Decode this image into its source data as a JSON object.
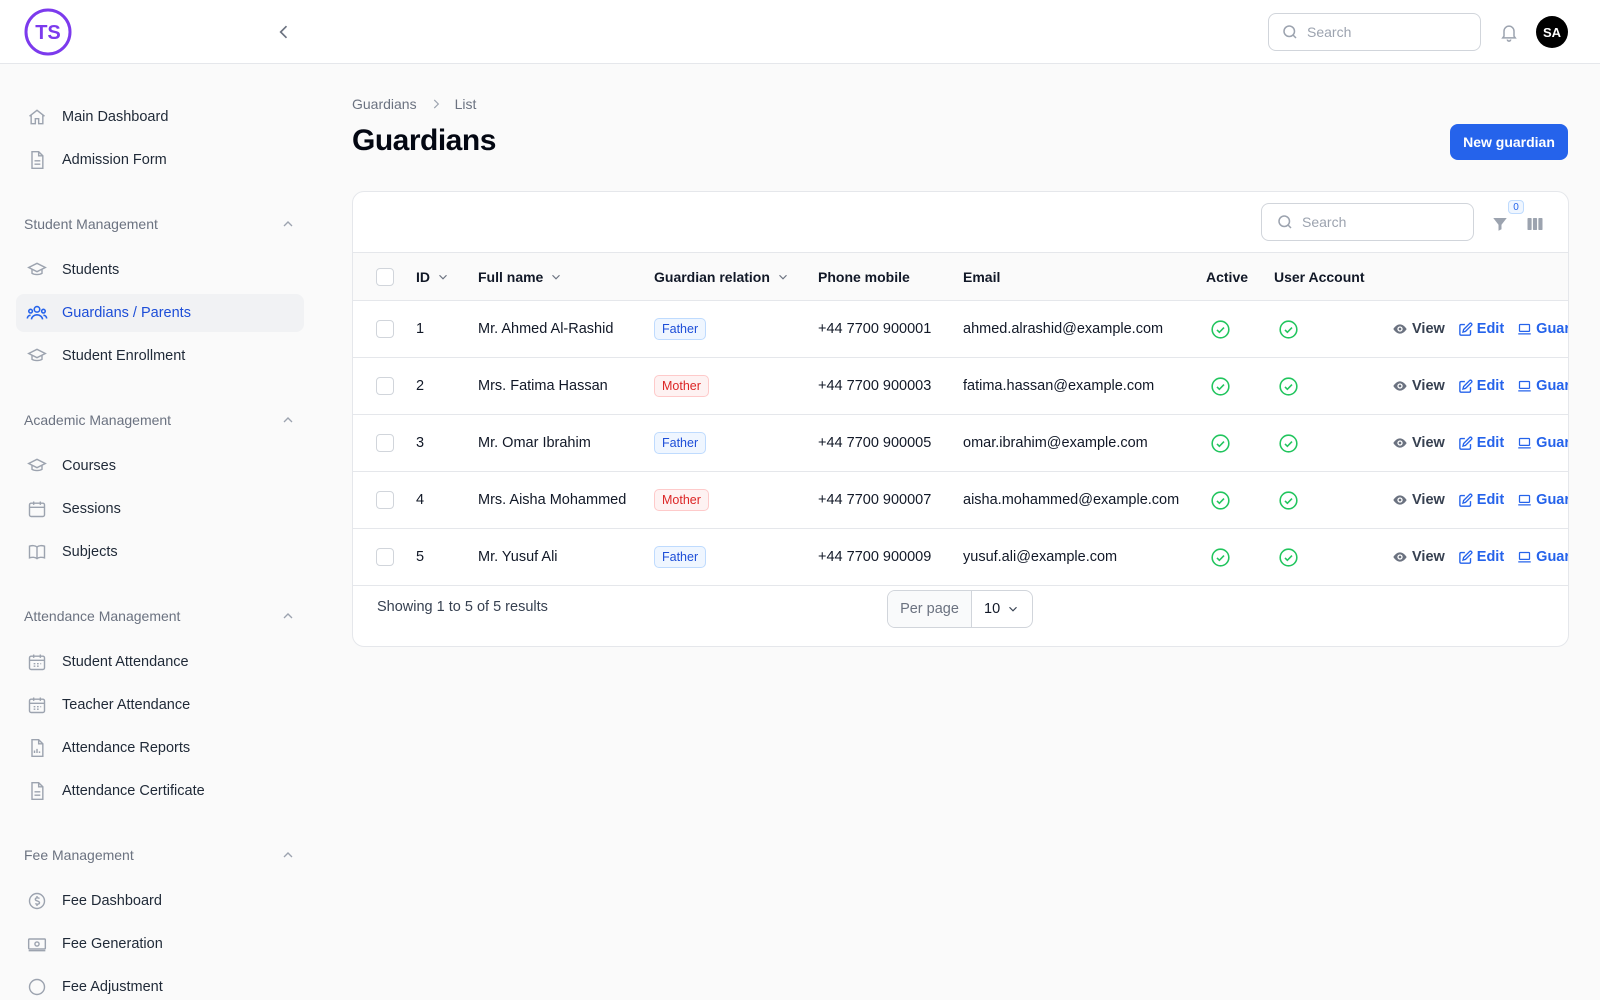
{
  "app": {
    "logo_text": "TS"
  },
  "topbar": {
    "search_placeholder": "Search",
    "avatar_initials": "SA"
  },
  "sidebar": {
    "top_items": [
      {
        "label": "Main Dashboard",
        "icon": "home-icon"
      },
      {
        "label": "Admission Form",
        "icon": "document-icon"
      }
    ],
    "groups": [
      {
        "label": "Student Management",
        "items": [
          {
            "label": "Students",
            "icon": "graduation-cap-icon"
          },
          {
            "label": "Guardians / Parents",
            "icon": "users-icon",
            "active": true
          },
          {
            "label": "Student Enrollment",
            "icon": "graduation-cap-icon"
          }
        ]
      },
      {
        "label": "Academic Management",
        "items": [
          {
            "label": "Courses",
            "icon": "graduation-cap-icon"
          },
          {
            "label": "Sessions",
            "icon": "calendar-icon"
          },
          {
            "label": "Subjects",
            "icon": "book-icon"
          }
        ]
      },
      {
        "label": "Attendance Management",
        "items": [
          {
            "label": "Student Attendance",
            "icon": "calendar-days-icon"
          },
          {
            "label": "Teacher Attendance",
            "icon": "calendar-days-icon"
          },
          {
            "label": "Attendance Reports",
            "icon": "chart-document-icon"
          },
          {
            "label": "Attendance Certificate",
            "icon": "document-icon"
          }
        ]
      },
      {
        "label": "Fee Management",
        "items": [
          {
            "label": "Fee Dashboard",
            "icon": "dollar-circle-icon"
          },
          {
            "label": "Fee Generation",
            "icon": "banknote-icon"
          },
          {
            "label": "Fee Adjustment",
            "icon": "adjust-icon"
          }
        ]
      }
    ]
  },
  "breadcrumb": {
    "parent": "Guardians",
    "current": "List"
  },
  "page": {
    "title": "Guardians",
    "new_button": "New guardian"
  },
  "table": {
    "search_placeholder": "Search",
    "filter_count": "0",
    "columns": {
      "id": "ID",
      "full_name": "Full name",
      "relation": "Guardian relation",
      "phone": "Phone mobile",
      "email": "Email",
      "active": "Active",
      "user_account": "User Account"
    },
    "rows": [
      {
        "id": "1",
        "name": "Mr. Ahmed Al-Rashid",
        "relation": "Father",
        "phone": "+44 7700 900001",
        "email": "ahmed.alrashid@example.com",
        "active": true,
        "user_account": true
      },
      {
        "id": "2",
        "name": "Mrs. Fatima Hassan",
        "relation": "Mother",
        "phone": "+44 7700 900003",
        "email": "fatima.hassan@example.com",
        "active": true,
        "user_account": true
      },
      {
        "id": "3",
        "name": "Mr. Omar Ibrahim",
        "relation": "Father",
        "phone": "+44 7700 900005",
        "email": "omar.ibrahim@example.com",
        "active": true,
        "user_account": true
      },
      {
        "id": "4",
        "name": "Mrs. Aisha Mohammed",
        "relation": "Mother",
        "phone": "+44 7700 900007",
        "email": "aisha.mohammed@example.com",
        "active": true,
        "user_account": true
      },
      {
        "id": "5",
        "name": "Mr. Yusuf Ali",
        "relation": "Father",
        "phone": "+44 7700 900009",
        "email": "yusuf.ali@example.com",
        "active": true,
        "user_account": true
      }
    ],
    "actions": {
      "view": "View",
      "edit": "Edit",
      "guardian": "Guardian"
    },
    "footer": {
      "summary": "Showing 1 to 5 of 5 results",
      "per_page_label": "Per page",
      "per_page_value": "10"
    }
  },
  "colors": {
    "primary": "#2563eb",
    "success": "#22c55e",
    "logo": "#7c3aed"
  }
}
